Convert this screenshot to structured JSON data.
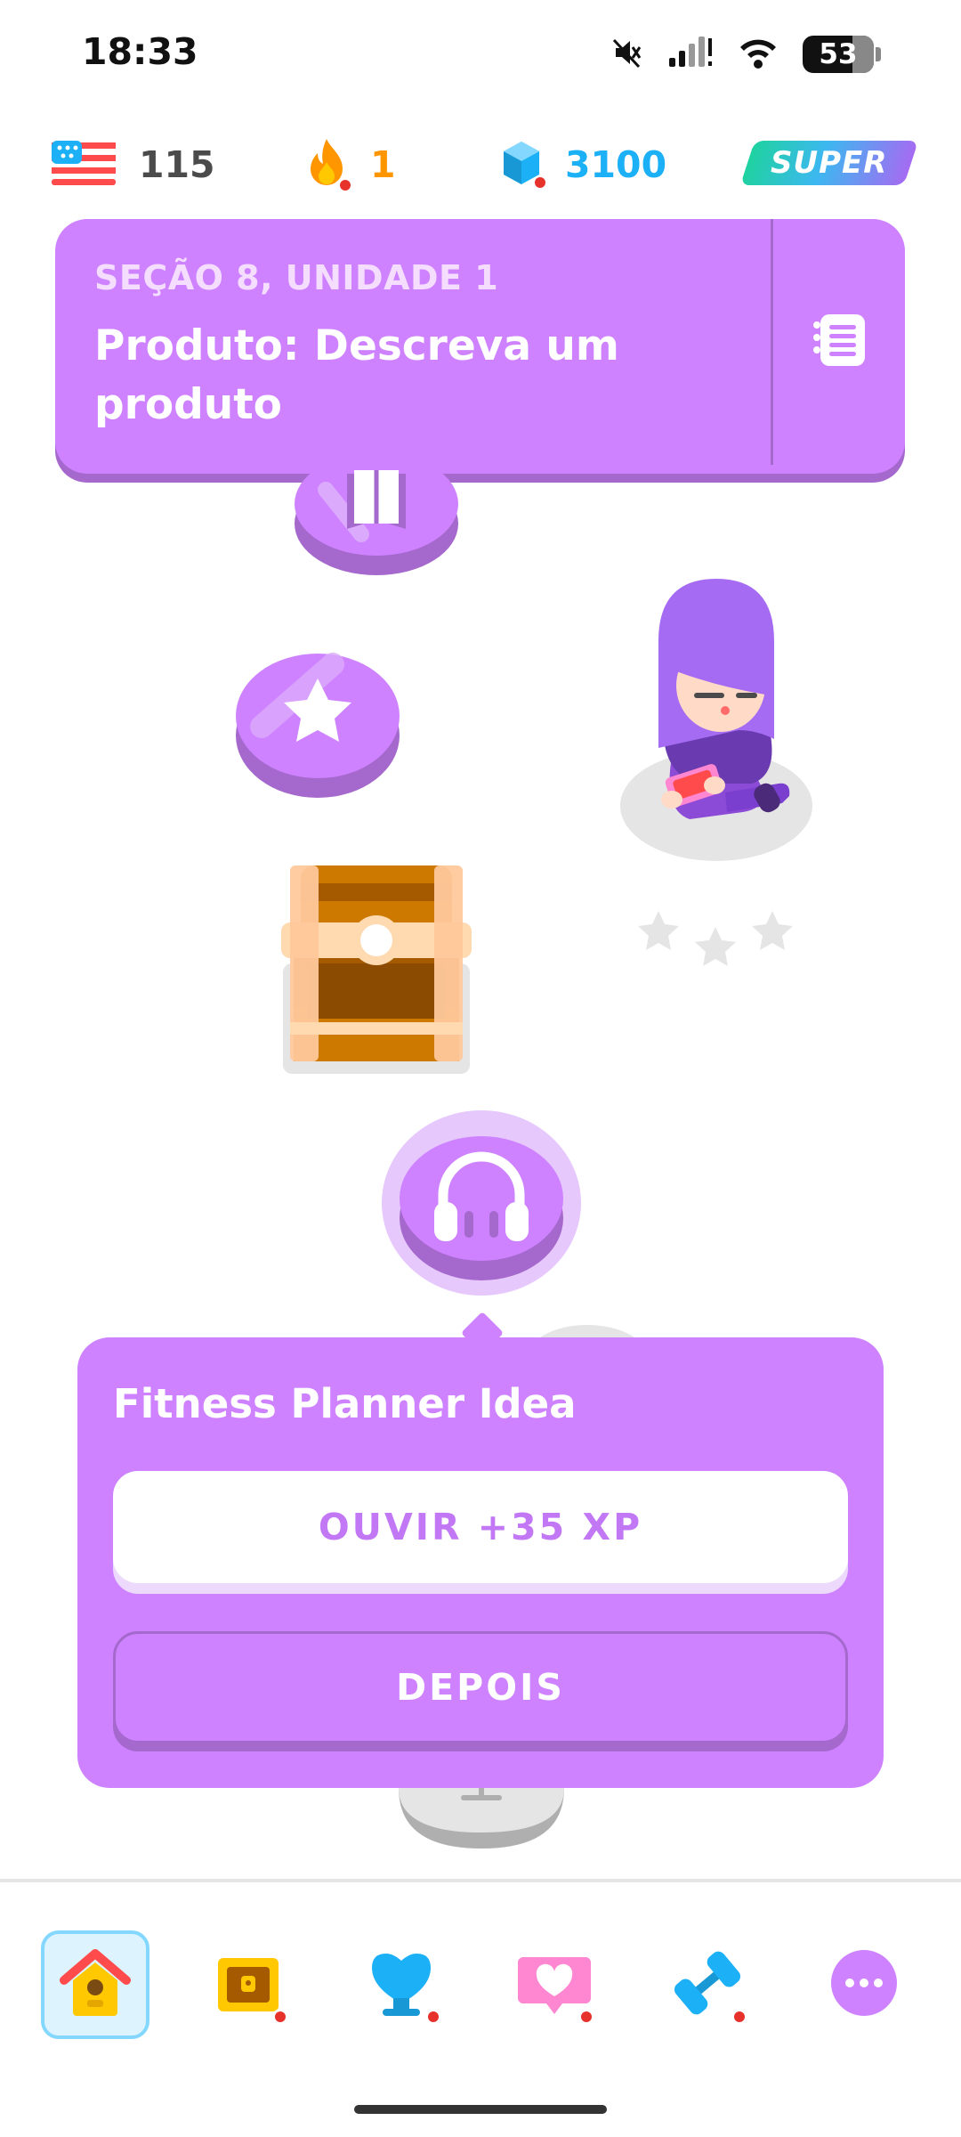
{
  "status_bar": {
    "time": "18:33",
    "battery": "53"
  },
  "stats": {
    "language_count": "115",
    "streak": "1",
    "gems": "3100",
    "super_label": "SUPER"
  },
  "banner": {
    "subtitle": "SEÇÃO 8, UNIDADE 1",
    "title": "Produto: Descreva um produto"
  },
  "path": {
    "star_rating": "0 of 3 stars"
  },
  "popup": {
    "title": "Fitness Planner Idea",
    "primary_button": "OUVIR +35 XP",
    "secondary_button": "DEPOIS"
  },
  "bottom_nav": {
    "items": [
      "home-icon",
      "league-chest-icon",
      "shield-leaderboard-icon",
      "heart-message-icon",
      "dumbbell-practice-icon",
      "more-icon"
    ]
  },
  "colors": {
    "accent_purple": "#ce82ff",
    "accent_purple_dark": "#a568cc",
    "streak_orange": "#ff9600",
    "gems_blue": "#1cb0f6"
  }
}
